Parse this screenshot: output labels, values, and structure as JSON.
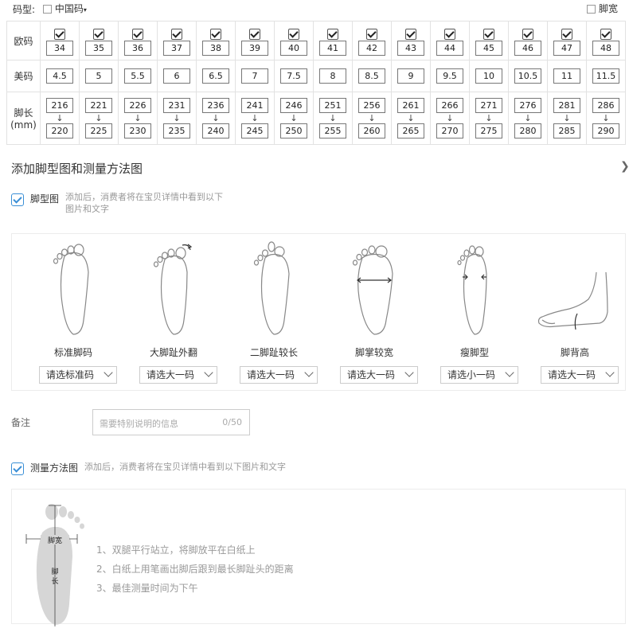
{
  "topbar": {
    "size_type_label": "码型:",
    "china_size_label": "中国码",
    "wide_foot_label": "脚宽"
  },
  "size_table": {
    "row_labels": [
      "欧码",
      "美码",
      "脚长",
      "(mm)"
    ],
    "eu": [
      "34",
      "35",
      "36",
      "37",
      "38",
      "39",
      "40",
      "41",
      "42",
      "43",
      "44",
      "45",
      "46",
      "47",
      "48"
    ],
    "us": [
      "4.5",
      "5",
      "5.5",
      "6",
      "6.5",
      "7",
      "7.5",
      "8",
      "8.5",
      "9",
      "9.5",
      "10",
      "10.5",
      "11",
      "11.5"
    ],
    "len_from": [
      "216",
      "221",
      "226",
      "231",
      "236",
      "241",
      "246",
      "251",
      "256",
      "261",
      "266",
      "271",
      "276",
      "281",
      "286"
    ],
    "len_to": [
      "220",
      "225",
      "230",
      "235",
      "240",
      "245",
      "250",
      "255",
      "260",
      "265",
      "270",
      "275",
      "280",
      "285",
      "290"
    ],
    "arrow": "↓"
  },
  "section": {
    "title": "添加脚型图和测量方法图",
    "close": "╳"
  },
  "foot_option": {
    "label": "脚型图",
    "desc_line1": "添加后，消费者将在宝贝详情中看到以下",
    "desc_line2": "图片和文字"
  },
  "foot_types": [
    {
      "name": "标准脚码",
      "select": "请选标准码"
    },
    {
      "name": "大脚趾外翻",
      "select": "请选大一码"
    },
    {
      "name": "二脚趾较长",
      "select": "请选大一码"
    },
    {
      "name": "脚掌较宽",
      "select": "请选大一码"
    },
    {
      "name": "瘦脚型",
      "select": "请选小一码"
    },
    {
      "name": "脚背高",
      "select": "请选大一码"
    }
  ],
  "note": {
    "label": "备注",
    "placeholder": "需要特别说明的信息",
    "counter": "0/50"
  },
  "measure_option": {
    "label": "测量方法图",
    "desc": "添加后，消费者将在宝贝详情中看到以下图片和文字"
  },
  "measure": {
    "width_label": "脚宽",
    "length_label_1": "脚",
    "length_label_2": "长",
    "steps": [
      "1、双腿平行站立，将脚放平在白纸上",
      "2、白纸上用笔画出脚后跟到最长脚趾头的距离",
      "3、最佳测量时间为下午"
    ]
  }
}
